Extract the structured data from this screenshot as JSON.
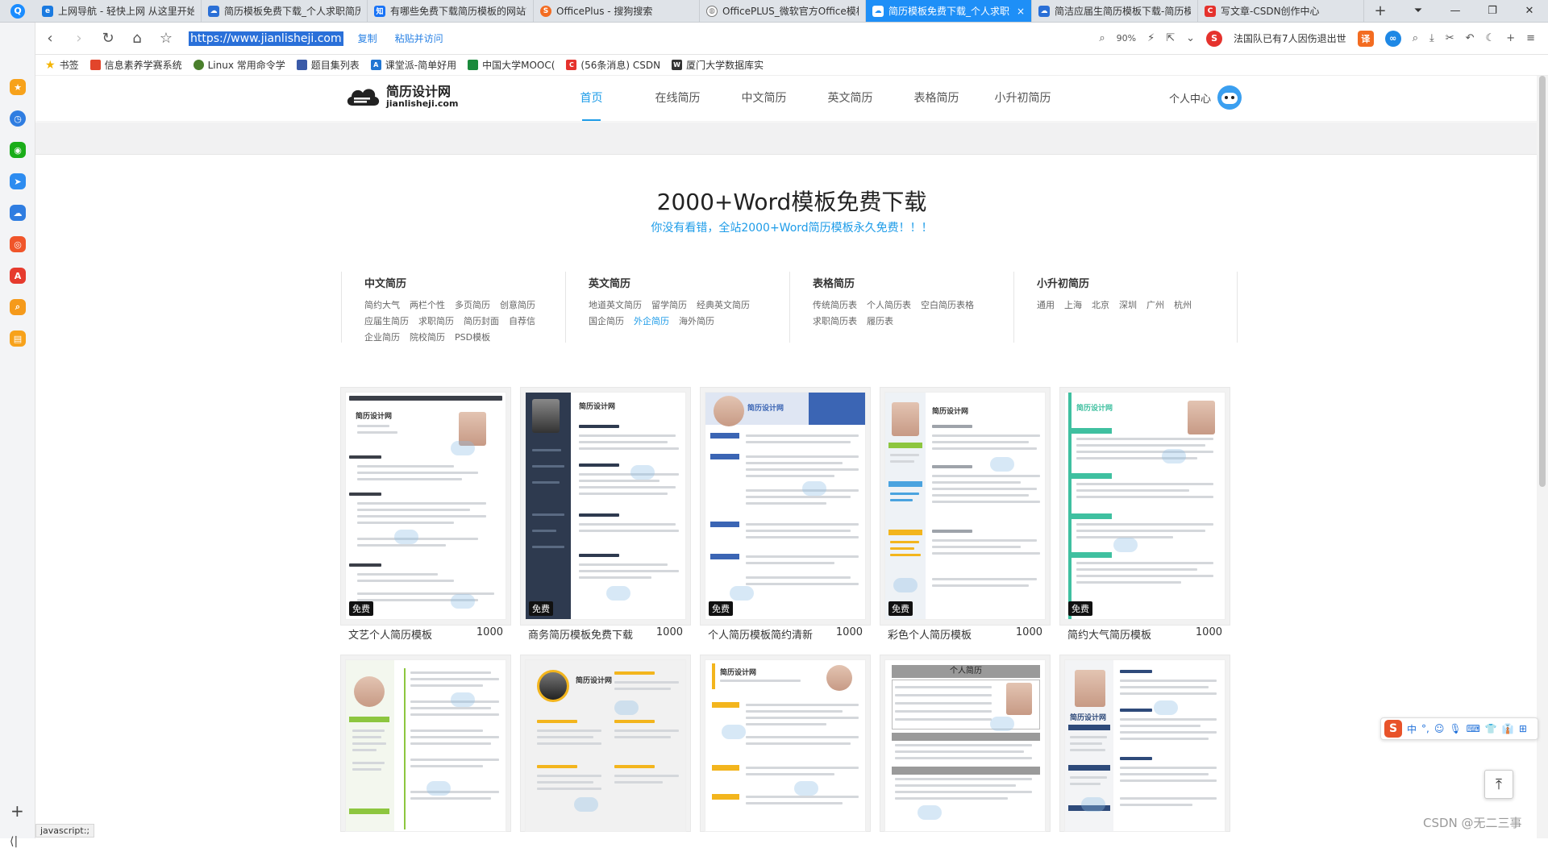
{
  "browser": {
    "tabs": [
      {
        "title": "上网导航 - 轻快上网 从这里开始",
        "icon_color": "#1a7ae0",
        "icon": "e"
      },
      {
        "title": "简历模板免费下载_个人求职简历",
        "icon_color": "#2a6fd6",
        "icon": "cloud"
      },
      {
        "title": "有哪些免费下载简历模板的网站？",
        "icon_color": "#1772f6",
        "icon": "知"
      },
      {
        "title": "OfficePlus - 搜狗搜索",
        "icon_color": "#f36c21",
        "icon": "S"
      },
      {
        "title": "OfficePLUS_微软官方Office模板",
        "icon_color": "#777777",
        "icon": "globe"
      },
      {
        "title": "简历模板免费下载_个人求职简历",
        "icon_color": "#ffffff",
        "icon": "cloud",
        "active": true
      },
      {
        "title": "简洁应届生简历模板下载-简历模",
        "icon_color": "#2a6fd6",
        "icon": "cloud"
      },
      {
        "title": "写文章-CSDN创作中心",
        "icon_color": "#e5322d",
        "icon": "C"
      }
    ],
    "tab_close": "×",
    "new_tab": "+",
    "url": "https://www.jianlisheji.com",
    "copy_label": "复制",
    "paste_go_label": "粘贴并访问",
    "zoom": "90%",
    "news_ticker": "法国队已有7人因伤退出世",
    "bookmarks_label": "书签",
    "bookmarks": [
      {
        "label": "信息素养学赛系统",
        "color": "#e2452b"
      },
      {
        "label": "Linux 常用命令学",
        "color": "#4a7f2c"
      },
      {
        "label": "题目集列表",
        "color": "#3a5aa8"
      },
      {
        "label": "课堂派-简单好用",
        "color": "#2176d2"
      },
      {
        "label": "中国大学MOOC(",
        "color": "#1b8a3c"
      },
      {
        "label": "(56条消息) CSDN",
        "color": "#e5322d"
      },
      {
        "label": "厦门大学数据库实",
        "color": "#333333"
      }
    ],
    "status_text": "javascript:;",
    "scroll_top_icon": "⤒"
  },
  "site": {
    "logo_name": "简历设计网",
    "logo_domain": "jianlisheji.com",
    "nav": [
      "首页",
      "在线简历",
      "中文简历",
      "英文简历",
      "表格简历",
      "小升初简历"
    ],
    "nav_active": 0,
    "user_center": "个人中心",
    "hero_title": "2000+Word模板免费下载",
    "hero_subtitle": "你没有看错，全站2000+Word简历模板永久免费！！！",
    "categories": [
      {
        "title": "中文简历",
        "links": [
          "简约大气",
          "两栏个性",
          "多页简历",
          "创意简历",
          "应届生简历",
          "求职简历",
          "简历封面",
          "自荐信",
          "企业简历",
          "院校简历",
          "PSD模板"
        ]
      },
      {
        "title": "英文简历",
        "links": [
          "地道英文简历",
          "留学简历",
          "经典英文简历",
          "国企简历",
          "外企简历",
          "海外简历"
        ],
        "highlight": "外企简历"
      },
      {
        "title": "表格简历",
        "links": [
          "传统简历表",
          "个人简历表",
          "空白简历表格",
          "求职简历表",
          "履历表"
        ]
      },
      {
        "title": "小升初简历",
        "links": [
          "通用",
          "上海",
          "北京",
          "深圳",
          "广州",
          "杭州"
        ]
      }
    ],
    "free_badge": "免费",
    "templates_row1": [
      {
        "name": "文艺个人简历模板",
        "count": "1000",
        "accent": "#3b3f48"
      },
      {
        "name": "商务简历模板免费下载",
        "count": "1000",
        "accent": "#2e3a4f"
      },
      {
        "name": "个人简历模板简约清新",
        "count": "1000",
        "accent": "#3b65b4"
      },
      {
        "name": "彩色个人简历模板",
        "count": "1000",
        "accent": "#8dc63f"
      },
      {
        "name": "简约大气简历模板",
        "count": "1000",
        "accent": "#3fc0a0"
      }
    ],
    "templates_row2": [
      {
        "accent": "#8dc63f"
      },
      {
        "accent": "#f3b51d"
      },
      {
        "accent": "#f3b51d"
      },
      {
        "accent": "#777777"
      },
      {
        "accent": "#2e4a7a"
      }
    ],
    "resume_thumb_title": "简历设计网",
    "resume_table_title": "个人简历"
  },
  "overlay": {
    "ime_items": [
      "S",
      "中",
      "°,",
      "☺",
      "🎙",
      "⌨",
      "👕",
      "👔",
      "⊞"
    ],
    "watermark_text": "CSDN @无二三事"
  }
}
